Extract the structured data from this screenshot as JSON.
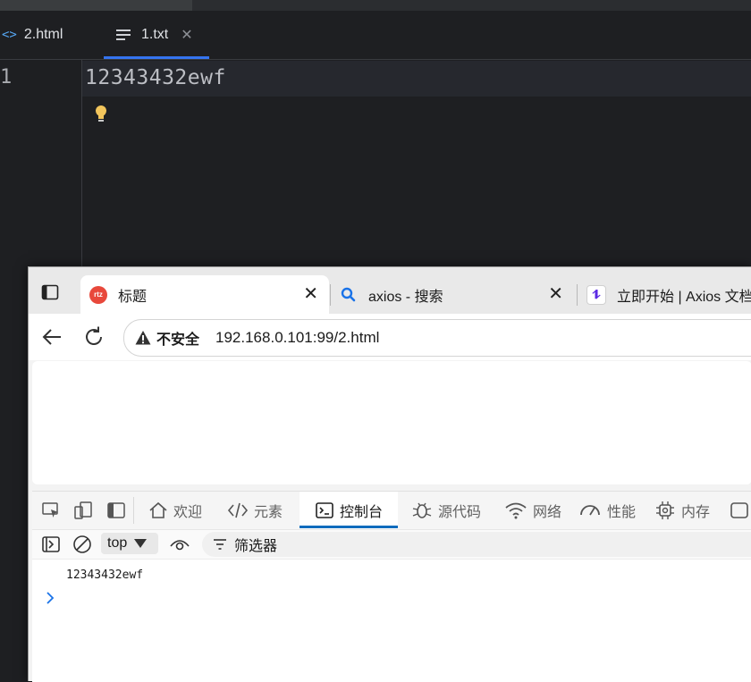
{
  "editor": {
    "tabs": [
      {
        "icon": "code-file-icon",
        "label": "2.html"
      },
      {
        "icon": "text-file-icon",
        "label": "1.txt",
        "active": true
      }
    ],
    "line_number": "1",
    "line_text": "12343432ewf",
    "accent_color": "#3574f0"
  },
  "browser": {
    "tabs": [
      {
        "favicon": "rtz-favicon",
        "title": "标题",
        "active": true
      },
      {
        "favicon": "search-icon",
        "title": "axios - 搜索"
      },
      {
        "favicon": "axios-logo-icon",
        "title": "立即开始 | Axios 文档"
      }
    ],
    "address": {
      "security_label": "不安全",
      "url": "192.168.0.101:99/2.html"
    },
    "devtools": {
      "tabs": [
        {
          "icon": "home-icon",
          "label": "欢迎"
        },
        {
          "icon": "elements-icon",
          "label": "元素"
        },
        {
          "icon": "console-icon",
          "label": "控制台",
          "active": true
        },
        {
          "icon": "bug-icon",
          "label": "源代码"
        },
        {
          "icon": "wifi-icon",
          "label": "网络"
        },
        {
          "icon": "gauge-icon",
          "label": "性能"
        },
        {
          "icon": "chip-icon",
          "label": "内存"
        }
      ],
      "context": "top",
      "filter_placeholder": "筛选器",
      "console_output": "12343432ewf",
      "accent_color": "#0f6cbd"
    }
  }
}
